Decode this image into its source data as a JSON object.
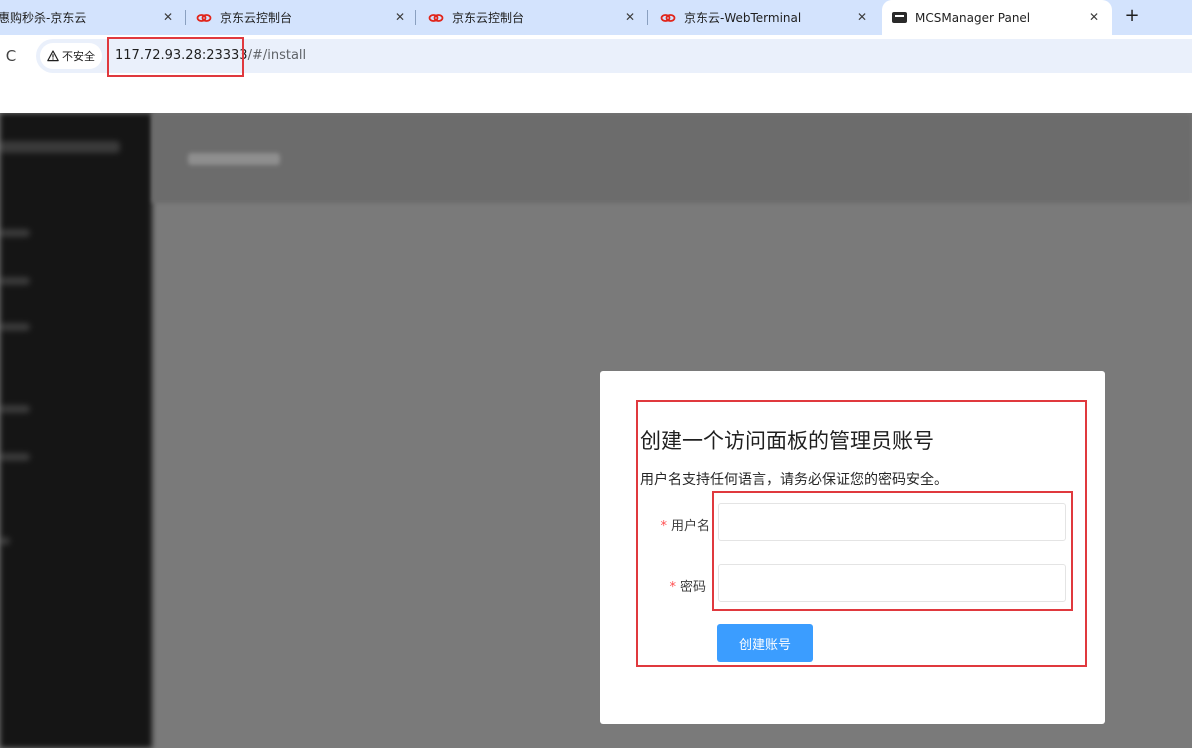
{
  "tabs": [
    {
      "title": "惠购秒杀-京东云",
      "favicon": "none",
      "active": false
    },
    {
      "title": "京东云控制台",
      "favicon": "jd-cloud-icon",
      "active": false
    },
    {
      "title": "京东云控制台",
      "favicon": "jd-cloud-icon",
      "active": false
    },
    {
      "title": "京东云-WebTerminal",
      "favicon": "jd-cloud-icon",
      "active": false
    },
    {
      "title": "MCSManager Panel",
      "favicon": "mcsmanager-icon",
      "active": true
    }
  ],
  "tab_close_glyph": "✕",
  "new_tab_glyph": "+",
  "reload_glyph": "C",
  "address_bar": {
    "security_label": "不安全",
    "url_host": "117.72.93.28:23333",
    "url_path": "/#/install"
  },
  "install_dialog": {
    "title": "创建一个访问面板的管理员账号",
    "description": "用户名支持任何语言，请务必保证您的密码安全。",
    "required_mark": "*",
    "username_label": "用户名",
    "username_value": "",
    "password_label": "密码",
    "password_value": "",
    "submit_label": "创建账号"
  },
  "colors": {
    "tabstrip": "#d3e3fd",
    "primary_button": "#3b9dff",
    "annotation": "#e0393e",
    "required": "#ff4d4f",
    "overlay": "#7a7a7a"
  }
}
